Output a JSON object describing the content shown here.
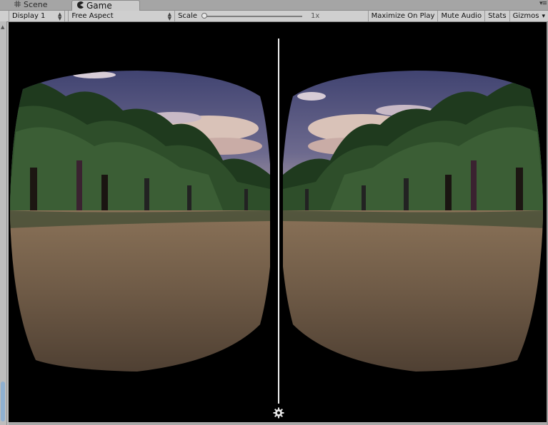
{
  "tabs": [
    {
      "label": "Scene",
      "icon": "grid-icon",
      "active": false
    },
    {
      "label": "Game",
      "icon": "pacman-icon",
      "active": true
    }
  ],
  "tab_menu_glyph": "▾≡",
  "toolbar": {
    "display": "Display 1",
    "aspect": "Free Aspect",
    "scale_label": "Scale",
    "scale_value": "1x",
    "scale_fraction": 0.0,
    "maximize": "Maximize On Play",
    "mute": "Mute Audio",
    "stats": "Stats",
    "gizmos": "Gizmos"
  },
  "glyphs": {
    "dropdown_up": "▲",
    "dropdown_down": "▼",
    "gizmos_arrow": "▾",
    "scroll_up": "▲"
  },
  "colors": {
    "editor_bg": "#c2c2c2",
    "game_bg": "#000000",
    "sky": "#4c4f78",
    "ground": "#7a6550"
  }
}
